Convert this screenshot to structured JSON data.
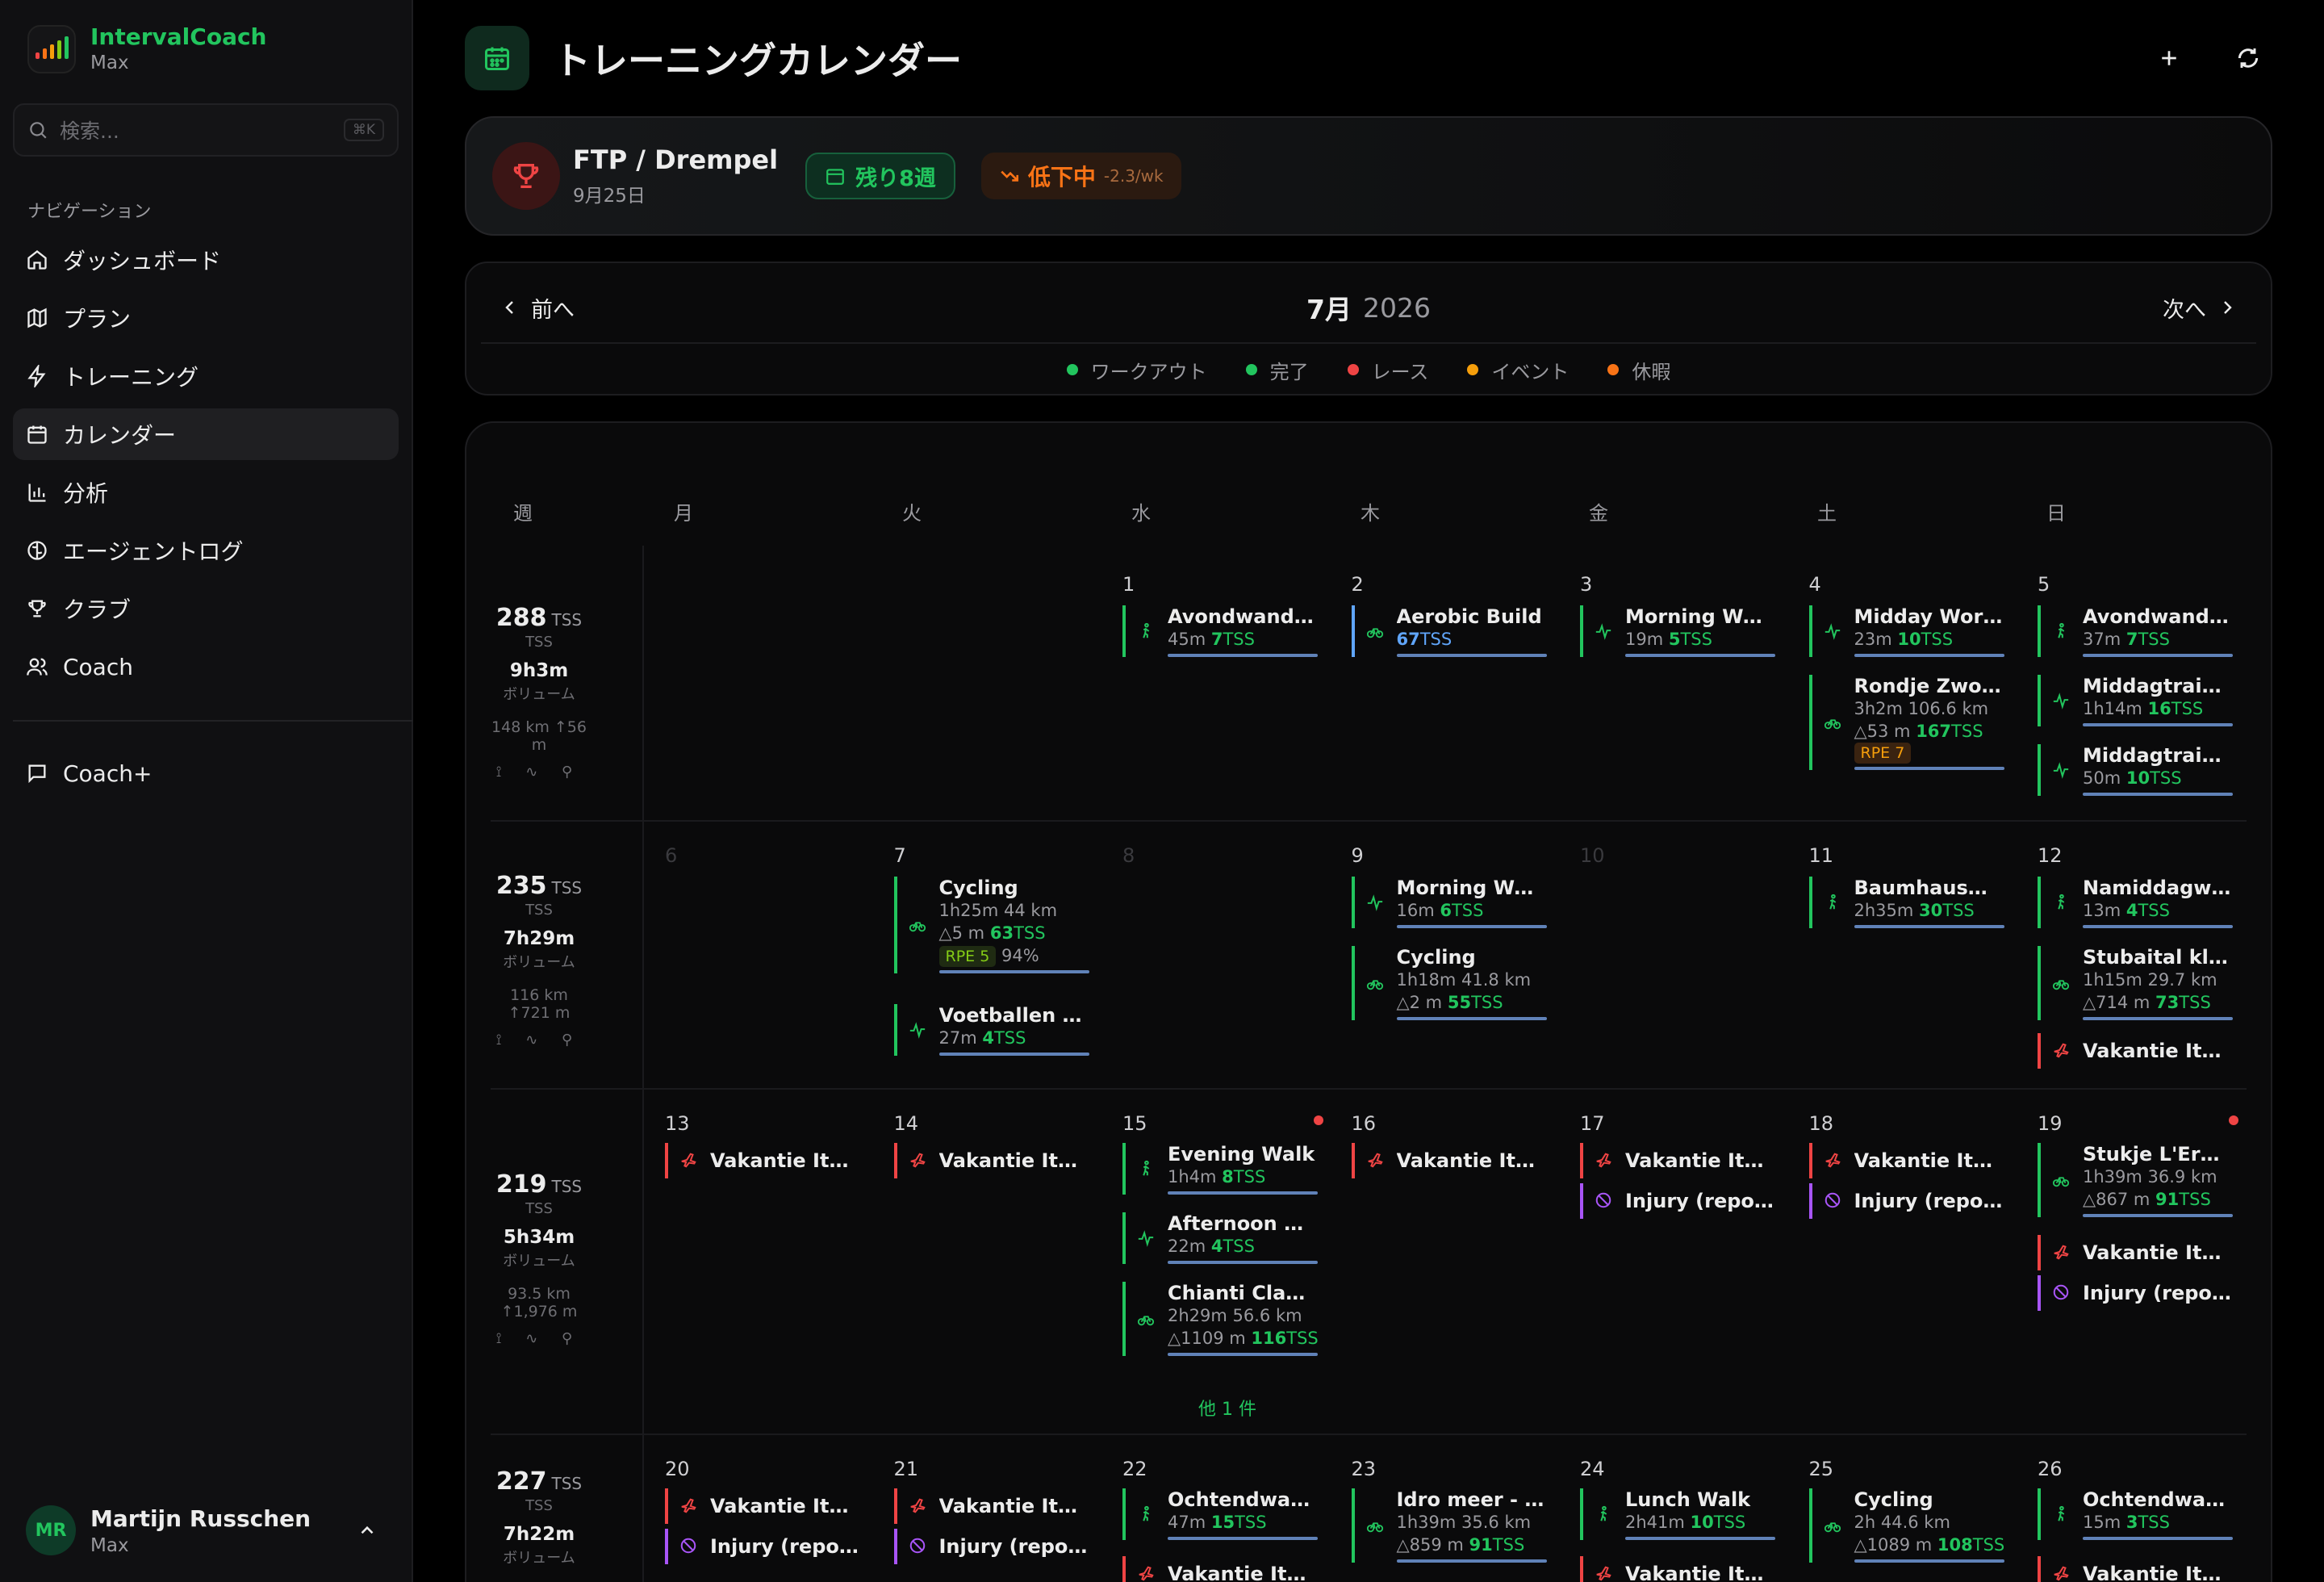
{
  "app": {
    "name": "IntervalCoach",
    "plan": "Max"
  },
  "search": {
    "placeholder": "検索...",
    "shortcut": "⌘K"
  },
  "nav": {
    "title": "ナビゲーション",
    "items": [
      "ダッシュボード",
      "プラン",
      "トレーニング",
      "カレンダー",
      "分析",
      "エージェントログ",
      "クラブ",
      "Coach"
    ],
    "extra": "Coach+"
  },
  "user": {
    "initials": "MR",
    "name": "Martijn Russchen",
    "plan": "Max"
  },
  "page": {
    "title": "トレーニングカレンダー"
  },
  "goal": {
    "title": "FTP / Drempel",
    "date": "9月25日",
    "weeks": "残り8週",
    "trend": "低下中",
    "trend_rate": "-2.3/wk"
  },
  "month": {
    "prev": "前へ",
    "next": "次へ",
    "month": "7月",
    "year": "2026"
  },
  "legend": [
    {
      "label": "ワークアウト",
      "color": "#22c55e"
    },
    {
      "label": "完了",
      "color": "#22c55e"
    },
    {
      "label": "レース",
      "color": "#ef4444"
    },
    {
      "label": "イベント",
      "color": "#f59e0b"
    },
    {
      "label": "休暇",
      "color": "#f97316"
    }
  ],
  "weekdays": [
    "週",
    "月",
    "火",
    "水",
    "木",
    "金",
    "土",
    "日"
  ],
  "weeks": [
    {
      "tss": "288",
      "tss_unit": "TSS",
      "tss_label": "TSS",
      "volume": "9h3m",
      "volume_label": "ボリューム",
      "dist": "148 km",
      "elev": "56 m",
      "icons": "🚶 〰 🚲",
      "days": [
        "",
        "",
        "1",
        "2",
        "3",
        "4",
        "5"
      ]
    },
    {
      "tss": "235",
      "tss_unit": "TSS",
      "tss_label": "TSS",
      "volume": "7h29m",
      "volume_label": "ボリューム",
      "dist": "116 km",
      "elev": "721 m",
      "icons": "🚶 🚲 〰",
      "days": [
        "6",
        "7",
        "8",
        "9",
        "10",
        "11",
        "12"
      ]
    },
    {
      "tss": "219",
      "tss_unit": "TSS",
      "tss_label": "TSS",
      "volume": "5h34m",
      "volume_label": "ボリューム",
      "dist": "93.5 km",
      "elev": "1,976 m",
      "icons": "🚲 🚶 〰",
      "days": [
        "13",
        "14",
        "15",
        "16",
        "17",
        "18",
        "19"
      ]
    },
    {
      "tss": "227",
      "tss_unit": "TSS",
      "tss_label": "TSS",
      "volume": "7h22m",
      "volume_label": "ボリューム",
      "dist": "",
      "elev": "",
      "icons": "",
      "days": [
        "20",
        "21",
        "22",
        "23",
        "24",
        "25",
        "26"
      ]
    }
  ],
  "events": {
    "w1": [
      {
        "title": "Avondwandeling",
        "meta": "45m",
        "tss": "7",
        "type": "walk"
      },
      {
        "title": "Aerobic Build",
        "meta": "",
        "tss": "67",
        "type": "bike",
        "planned": true
      },
      {
        "title": "Morning Worko...",
        "meta": "19m",
        "tss": "5",
        "type": "hr"
      },
      {
        "title": "Midday Workout",
        "meta": "23m",
        "tss": "10",
        "type": "hr"
      },
      {
        "title": "Rondje Zwolle ...",
        "meta": "3h2m  106.6 km",
        "meta2": "53 m",
        "tss": "167",
        "rpe": "RPE 7",
        "type": "bike"
      },
      {
        "title": "Avondwandeling",
        "meta": "37m",
        "tss": "7",
        "type": "walk"
      },
      {
        "title": "Middagtraining",
        "meta": "1h14m",
        "tss": "16",
        "type": "hr"
      },
      {
        "title": "Middagtraining",
        "meta": "50m",
        "tss": "10",
        "type": "hr"
      }
    ],
    "w2": [
      {
        "title": "Cycling",
        "meta": "1h25m  44 km",
        "meta2": "5 m",
        "tss": "63",
        "rpe": "RPE 5",
        "pct": "94%",
        "type": "bike"
      },
      {
        "title": "Voetballen in d...",
        "meta": "27m",
        "tss": "4",
        "type": "hr"
      },
      {
        "title": "Morning Worko...",
        "meta": "16m",
        "tss": "6",
        "type": "hr"
      },
      {
        "title": "Cycling",
        "meta": "1h18m  41.8 km",
        "meta2": "2 m",
        "tss": "55",
        "type": "bike"
      },
      {
        "title": "Baumhausweg",
        "meta": "2h35m",
        "tss": "30",
        "type": "walk"
      },
      {
        "title": "Namiddagwan...",
        "meta": "13m",
        "tss": "4",
        "type": "walk"
      },
      {
        "title": "Stubaital klim ...",
        "meta": "1h15m  29.7 km",
        "meta2": "714 m",
        "tss": "73",
        "type": "bike"
      },
      {
        "title": "Vakantie Italie",
        "type": "vac"
      }
    ],
    "w3": [
      {
        "title": "Vakantie Italie",
        "type": "vac"
      },
      {
        "title": "Vakantie Italie",
        "type": "vac"
      },
      {
        "title": "Evening Walk",
        "meta": "1h4m",
        "tss": "8",
        "type": "walk"
      },
      {
        "title": "Afternoon Wor...",
        "meta": "22m",
        "tss": "4",
        "type": "hr"
      },
      {
        "title": "Chianti Classico",
        "meta": "2h29m  56.6 km",
        "meta2": "1109 m",
        "tss": "116",
        "type": "bike"
      },
      {
        "title": "他 1 件",
        "type": "more"
      },
      {
        "title": "Vakantie Italie",
        "type": "vac"
      },
      {
        "title": "Vakantie Italie",
        "type": "vac"
      },
      {
        "title": "Injury (reported...",
        "type": "inj"
      },
      {
        "title": "Vakantie Italie",
        "type": "vac"
      },
      {
        "title": "Injury (reported...",
        "type": "inj"
      },
      {
        "title": "Stukje L'Eroica",
        "meta": "1h39m  36.9 km",
        "meta2": "867 m",
        "tss": "91",
        "type": "bike"
      },
      {
        "title": "Vakantie Italie",
        "type": "vac"
      },
      {
        "title": "Injury (reported...",
        "type": "inj"
      }
    ],
    "w4": [
      {
        "title": "Vakantie Italie",
        "type": "vac"
      },
      {
        "title": "Injury (reported...",
        "type": "inj"
      },
      {
        "title": "Vakantie Italie",
        "type": "vac"
      },
      {
        "title": "Injury (reported...",
        "type": "inj"
      },
      {
        "title": "Ochtendwande...",
        "meta": "47m",
        "tss": "15",
        "type": "walk"
      },
      {
        "title": "Vakantie Italie",
        "type": "vac"
      },
      {
        "title": "Idro meer - Ro...",
        "meta": "1h39m  35.6 km",
        "meta2": "859 m",
        "tss": "91",
        "type": "bike"
      },
      {
        "title": "Lunch Walk",
        "meta": "2h41m",
        "tss": "10",
        "type": "walk"
      },
      {
        "title": "Vakantie Italie",
        "type": "vac"
      },
      {
        "title": "Cycling",
        "meta": "2h  44.6 km",
        "meta2": "1089 m",
        "tss": "108",
        "type": "bike"
      },
      {
        "title": "Ochtendwande...",
        "meta": "15m",
        "tss": "3",
        "type": "walk"
      },
      {
        "title": "Vakantie Italie",
        "type": "vac"
      }
    ]
  },
  "tss_unit": "TSS"
}
